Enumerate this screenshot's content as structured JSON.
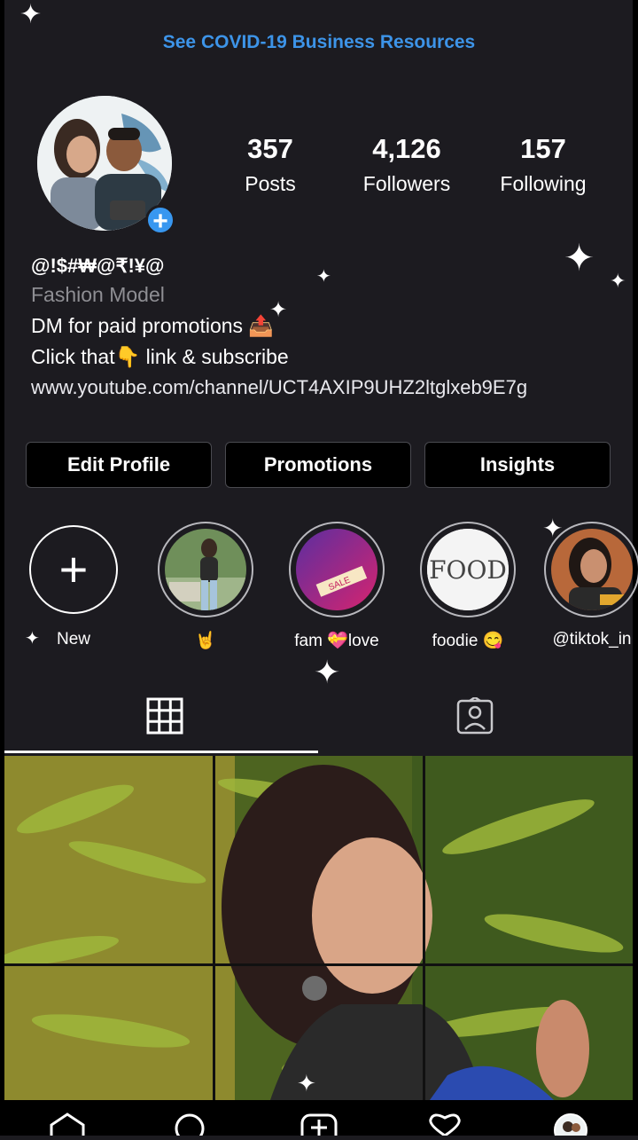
{
  "banner": {
    "text": "See COVID-19 Business Resources"
  },
  "profile": {
    "stats": [
      {
        "value": "357",
        "label": "Posts"
      },
      {
        "value": "4,126",
        "label": "Followers"
      },
      {
        "value": "157",
        "label": "Following"
      }
    ],
    "name": "@!$#₩@₹!¥@",
    "category": "Fashion Model",
    "bio_line1": "DM for paid promotions 📤",
    "bio_line2": "Click that👇 link & subscribe",
    "link": "www.youtube.com/channel/UCT4AXIP9UHZ2ltglxeb9E7g"
  },
  "buttons": {
    "edit": "Edit Profile",
    "promotions": "Promotions",
    "insights": "Insights"
  },
  "highlights": [
    {
      "label": "New"
    },
    {
      "label": "🤘"
    },
    {
      "label": "fam 💝love"
    },
    {
      "label": "foodie 😋"
    },
    {
      "label": "@tiktok_in"
    }
  ],
  "highlight_art": {
    "food_text": "FOOD",
    "sale_text": "SALE"
  },
  "colors": {
    "accent": "#3d94e8",
    "background": "#1c1b20",
    "add_badge": "#3897f0"
  },
  "icons": {
    "tab_grid": "grid-icon",
    "tab_tagged": "tagged-icon",
    "nav": [
      "home-icon",
      "search-icon",
      "add-post-icon",
      "heart-icon",
      "profile-avatar"
    ]
  }
}
